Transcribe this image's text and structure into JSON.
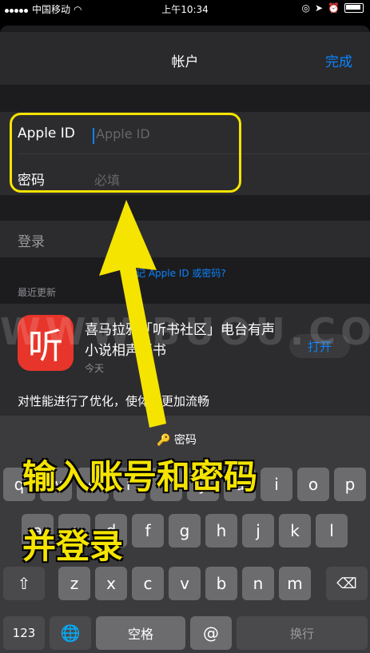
{
  "status_bar": {
    "carrier": "中国移动",
    "time": "上午10:34"
  },
  "nav": {
    "title": "帐户",
    "done": "完成"
  },
  "form": {
    "apple_id_label": "Apple ID",
    "apple_id_placeholder": "Apple ID",
    "password_label": "密码",
    "password_placeholder": "必填",
    "login_label": "登录",
    "forgot_link": "忘记 Apple ID 或密码?"
  },
  "updates": {
    "section_title": "最近更新",
    "app_name": "喜马拉雅「听书社区」电台有声小说相声评书",
    "app_date": "今天",
    "open_button": "打开",
    "note": "对性能进行了优化，使体验更加流畅",
    "app_icon_glyph": "听"
  },
  "keyboard": {
    "suggestion": "密码",
    "row1": [
      "q",
      "w",
      "e",
      "r",
      "t",
      "y",
      "u",
      "i",
      "o",
      "p"
    ],
    "row2": [
      "a",
      "s",
      "d",
      "f",
      "g",
      "h",
      "j",
      "k",
      "l"
    ],
    "row3": [
      "z",
      "x",
      "c",
      "v",
      "b",
      "n",
      "m"
    ],
    "numbers_key": "123",
    "space_key": "空格",
    "at_key": "@",
    "return_key": "换行"
  },
  "overlay": {
    "caption_line1": "输入账号和密码",
    "caption_line2": "并登录",
    "watermark": "WWW.BUOU.CO",
    "highlight_color": "#f5e400"
  },
  "colors": {
    "accent": "#0a84ff",
    "app_icon": "#e8352b"
  }
}
